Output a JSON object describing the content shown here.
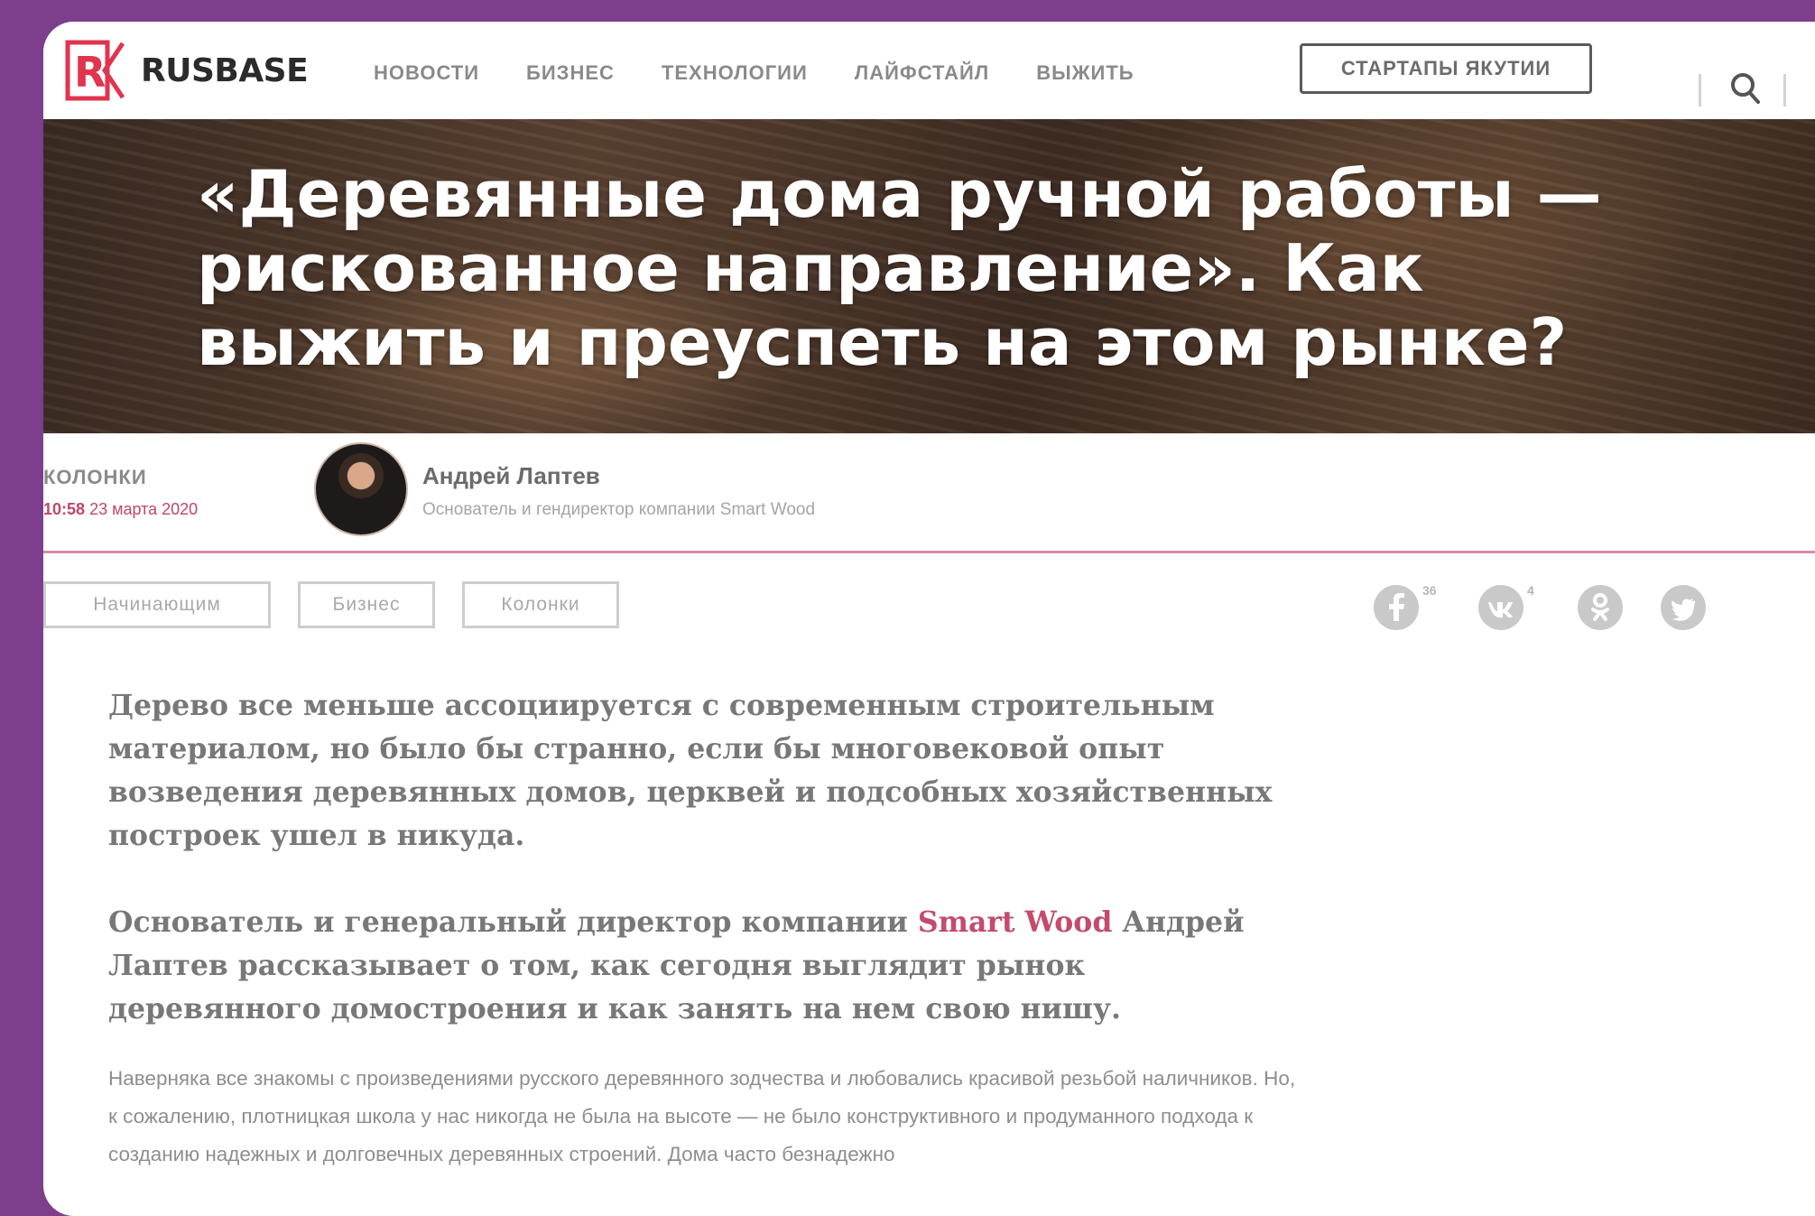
{
  "site": {
    "logo_text": "RUSBASE",
    "brand_color": "#e0344f",
    "background_color": "#7d3f8c"
  },
  "nav": {
    "items": [
      "НОВОСТИ",
      "БИЗНЕС",
      "ТЕХНОЛОГИИ",
      "ЛАЙФСТАЙЛ",
      "ВЫЖИТЬ"
    ],
    "startups_button": "СТАРТАПЫ ЯКУТИИ",
    "search_icon": "search-icon"
  },
  "article": {
    "title": "«Деревянные дома ручной работы — рискованное направление». Как выжить и преуспеть на этом рынке?",
    "category": "КОЛОНКИ",
    "time": "10:58",
    "date": "23 марта 2020",
    "author": {
      "name": "Андрей Лаптев",
      "role": "Основатель и гендиректор компании Smart Wood"
    },
    "tags": [
      "Начинающим",
      "Бизнес",
      "Колонки"
    ],
    "share": [
      {
        "icon": "facebook-icon",
        "count": "36"
      },
      {
        "icon": "vk-icon",
        "count": "4"
      },
      {
        "icon": "odnoklassniki-icon",
        "count": ""
      },
      {
        "icon": "twitter-icon",
        "count": ""
      }
    ],
    "lead_1": "Дерево все меньше ассоциируется с современным строительным материалом, но было бы странно, если бы многовековой опыт возведения деревянных домов, церквей и подсобных хозяйственных построек ушел в никуда.",
    "lead_2_before": "Основатель и генеральный директор компании ",
    "lead_2_link": "Smart Wood",
    "lead_2_after": " Андрей Лаптев рассказывает о том, как сегодня выглядит рынок деревянного домостроения и как занять на нем свою нишу.",
    "body": "Наверняка все знакомы с произведениями русского деревянного зодчества и любовались красивой резьбой наличников. Но, к сожалению, плотницкая школа у нас никогда не была на высоте — не было конструктивного и продуманного подхода к созданию надежных и долговечных деревянных строений. Дома часто безнадежно"
  }
}
